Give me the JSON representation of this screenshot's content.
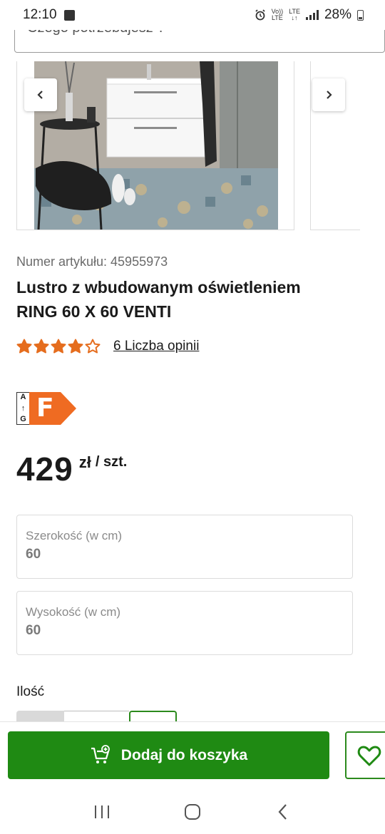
{
  "status_bar": {
    "time": "12:10",
    "volte_top": "Vo))",
    "volte_bottom": "LTE",
    "network": "LTE",
    "battery": "28%"
  },
  "search": {
    "placeholder": "Czego potrzebujesz ?"
  },
  "product": {
    "article_number": "Numer artykułu: 45955973",
    "title_line1": "Lustro z wbudowanym oświetleniem",
    "title_line2": "RING 60 X 60 VENTI",
    "rating": 4,
    "rating_max": 5,
    "reviews_link": "6 Liczba opinii",
    "energy_scale_top": "A",
    "energy_scale_bottom": "G",
    "energy_class": "F",
    "price_amount": "429",
    "price_currency": "zł",
    "price_unit": "/ szt."
  },
  "options": {
    "width": {
      "label": "Szerokość (w cm)",
      "value": "60"
    },
    "height": {
      "label": "Wysokość (w cm)",
      "value": "60"
    }
  },
  "quantity": {
    "label": "Ilość"
  },
  "actions": {
    "add_to_cart": "Dodaj do koszyka"
  },
  "icons": {
    "carousel_prev": "chevron-left-icon",
    "carousel_next": "chevron-right-icon",
    "cart": "cart-plus-icon",
    "wishlist": "heart-icon"
  },
  "colors": {
    "brand_green": "#1f8a13",
    "star_orange": "#e56d1e",
    "energy_orange": "#ef6b22"
  }
}
